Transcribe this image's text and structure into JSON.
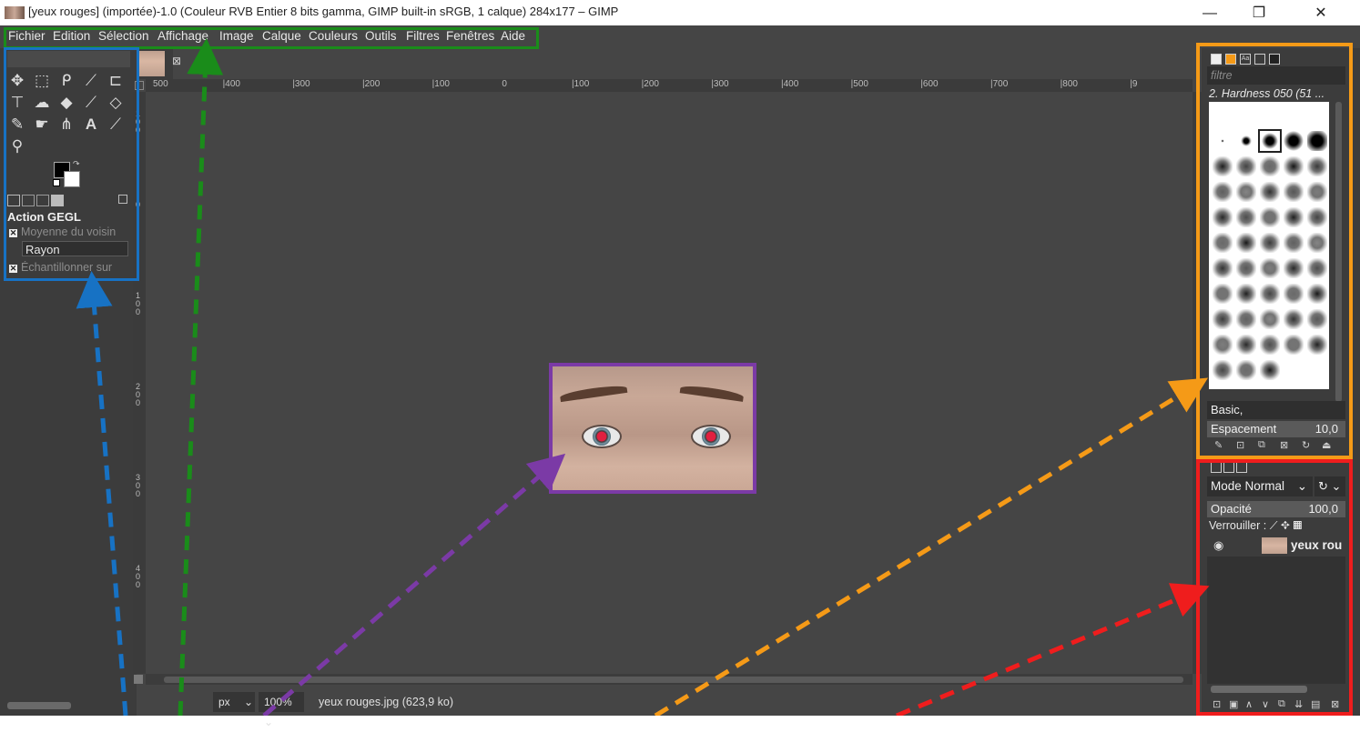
{
  "window": {
    "title": "[yeux rouges] (importée)-1.0 (Couleur RVB Entier 8 bits gamma, GIMP built-in sRGB, 1 calque) 284x177 – GIMP",
    "minimize": "—",
    "maximize": "❐",
    "close": "✕"
  },
  "menubar": [
    "Fichier",
    "Edition",
    "Sélection",
    "Affichage",
    "Image",
    "Calque",
    "Couleurs",
    "Outils",
    "Filtres",
    "Fenêtres",
    "Aide"
  ],
  "toolbox": {
    "tools": [
      "move-tool-icon",
      "rect-select-tool-icon",
      "free-select-tool-icon",
      "fuzzy-select-tool-icon",
      "crop-tool-icon",
      "transform-tool-icon",
      "warp-tool-icon",
      "bucket-fill-tool-icon",
      "paintbrush-tool-icon",
      "eraser-tool-icon",
      "heal-tool-icon",
      "smudge-tool-icon",
      "path-tool-icon",
      "text-tool-icon",
      "color-picker-tool-icon",
      "zoom-tool-icon"
    ],
    "tool_glyphs": [
      "✥",
      "⬚",
      "ᑭ",
      "⟋",
      "⊏",
      "⊤",
      "☁",
      "◆",
      "⟋",
      "◇",
      "✎",
      "☛",
      "⋔",
      "A",
      "⟋",
      "⚲"
    ],
    "options": {
      "title": "Action GEGL",
      "opt1": "Moyenne du voisin",
      "field": "Rayon",
      "opt2": "Échantillonner sur"
    }
  },
  "ruler_h": [
    "500",
    "|400",
    "|300",
    "|200",
    "|100",
    "0",
    "|100",
    "|200",
    "|300",
    "|400",
    "|500",
    "|600",
    "|700",
    "|800",
    "|9"
  ],
  "ruler_v": [
    "1\n0\n0",
    "0",
    "1\n0\n0",
    "2\n0\n0",
    "3\n0\n0",
    "4\n0\n0"
  ],
  "status": {
    "unit": "px",
    "zoom": "100%",
    "file": "yeux rouges.jpg (623,9 ko)"
  },
  "brushes": {
    "filter_placeholder": "filtre",
    "selected": "2. Hardness 050 (51 ...",
    "preset": "Basic,",
    "spacing_label": "Espacement",
    "spacing_value": "10,0"
  },
  "layers": {
    "mode": "Mode Normal",
    "opacity_label": "Opacité",
    "opacity_value": "100,0",
    "lock_label": "Verrouiller :",
    "layer_name": "yeux rou"
  },
  "colors": {
    "menubar_box": "#1a8c1a",
    "toolbox_box": "#1772c4",
    "image_box": "#7b3aa6",
    "brushes_box": "#f59a17",
    "layers_box": "#ef1d1d"
  }
}
